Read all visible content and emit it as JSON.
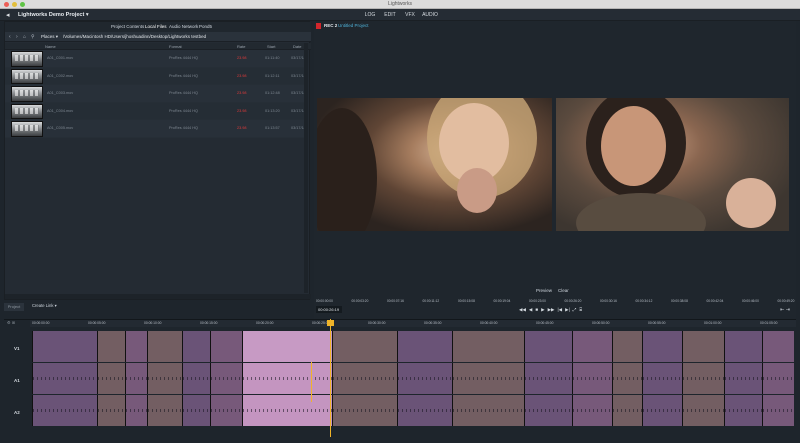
{
  "window": {
    "title": "Lightworks",
    "colors": {
      "close": "#ec5f57",
      "minimize": "#e2bf3c",
      "zoom": "#5ec346"
    }
  },
  "project": {
    "back_icon": "back-arrow-icon",
    "name": "Lightworks Demo Project ▾"
  },
  "modes": [
    "LOG",
    "EDIT",
    "VFX",
    "AUDIO"
  ],
  "left_tabs": [
    "Project Contents",
    "Local Files",
    "Audio Network",
    "Pond5"
  ],
  "left_active_tab": "Local Files",
  "pathbar": {
    "places_label": "Places ▾",
    "path": "/Volumes/Macintosh HD/Users/jhoshuadinn/Desktop/Lightworks testbed"
  },
  "file_columns": [
    "Name",
    "Format",
    "Rate",
    "Start",
    "Date"
  ],
  "files": [
    {
      "name": "A01_C001.mov",
      "format": "ProRes 4444 HQ",
      "rate": "23.98",
      "start": "01:11:40",
      "date": "03/17/18"
    },
    {
      "name": "A01_C002.mov",
      "format": "ProRes 4444 HQ",
      "rate": "23.98",
      "start": "01:12:11",
      "date": "03/17/18"
    },
    {
      "name": "A01_C003.mov",
      "format": "ProRes 4444 HQ",
      "rate": "23.98",
      "start": "01:12:48",
      "date": "03/17/18"
    },
    {
      "name": "A01_C004.mov",
      "format": "ProRes 4444 HQ",
      "rate": "23.98",
      "start": "01:13:20",
      "date": "03/17/18"
    },
    {
      "name": "A01_C005.mov",
      "format": "ProRes 4444 HQ",
      "rate": "23.98",
      "start": "01:13:57",
      "date": "03/17/18"
    }
  ],
  "viewer": {
    "source_label": "REC 2",
    "sequence_label": "Untitled Project",
    "preview_button": "Preview",
    "clear_button": "Clear"
  },
  "timecode": "00:00:26:19",
  "small_ruler": [
    "00:00:00:00",
    "00:00:03:20",
    "00:00:07:16",
    "00:00:11:12",
    "00:00:15:08",
    "00:00:19:04",
    "00:00:23:00",
    "00:00:26:20",
    "00:00:30:16",
    "00:00:34:12",
    "00:00:38:08",
    "00:00:42:04",
    "00:00:46:00",
    "00:00:49:20"
  ],
  "transport_icons": [
    "◀◀",
    "◀",
    "■",
    "▶",
    "▶▶",
    "|◀",
    "▶|",
    "⤢",
    "⌸"
  ],
  "left_strip": {
    "project_tab": "Project",
    "create_link": "Create Link ▾"
  },
  "timeline_ruler": [
    "00:00:00:00",
    "00:00:05:00",
    "00:00:10:00",
    "00:00:15:00",
    "00:00:20:00",
    "00:00:25:00",
    "00:00:30:00",
    "00:00:35:00",
    "00:00:40:00",
    "00:00:45:00",
    "00:00:50:00",
    "00:00:55:00",
    "00:01:00:00",
    "00:01:05:00"
  ],
  "tracks": [
    "V1",
    "A1",
    "A2"
  ],
  "track_colors": {
    "purple": "#6a5377",
    "mauve": "#77597a",
    "tan": "#735e62",
    "highlight": "#c79ac4"
  }
}
